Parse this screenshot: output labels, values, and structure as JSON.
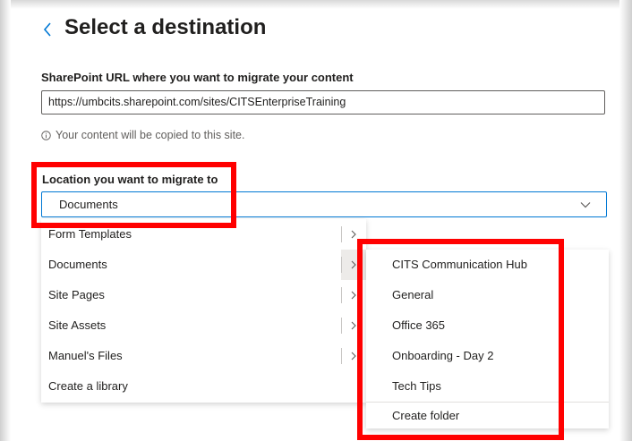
{
  "header": {
    "title": "Select a destination"
  },
  "url_section": {
    "label": "SharePoint URL where you want to migrate your content",
    "value": "https://umbcits.sharepoint.com/sites/CITSEnterpriseTraining",
    "note": "Your content will be copied to this site."
  },
  "location_section": {
    "label": "Location you want to migrate to",
    "selected": "Documents"
  },
  "library_menu": {
    "items": [
      {
        "label": "Form Templates"
      },
      {
        "label": "Documents"
      },
      {
        "label": "Site Pages"
      },
      {
        "label": "Site Assets"
      },
      {
        "label": "Manuel's Files"
      },
      {
        "label": "Create a library"
      }
    ]
  },
  "folder_menu": {
    "items": [
      {
        "label": "CITS Communication Hub"
      },
      {
        "label": "General"
      },
      {
        "label": "Office 365"
      },
      {
        "label": "Onboarding - Day 2"
      },
      {
        "label": "Tech Tips"
      }
    ],
    "create_label": "Create folder"
  },
  "colors": {
    "accent": "#0078d4",
    "highlight": "#ff0000",
    "text": "#201f1e",
    "subtext": "#605e5c"
  },
  "icons": {
    "back": "chevron-left-icon",
    "info": "info-icon",
    "dropdown": "chevron-down-icon",
    "submenu": "chevron-right-icon"
  }
}
